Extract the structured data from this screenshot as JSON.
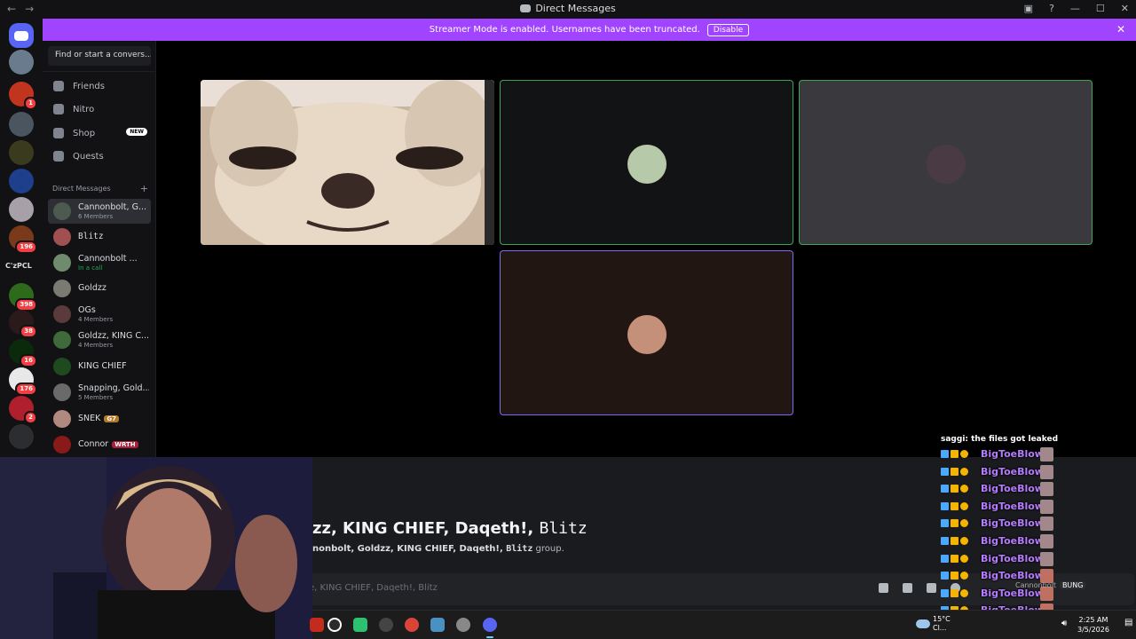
{
  "titlebar": {
    "title": "Direct Messages",
    "back": "←",
    "forward": "→"
  },
  "banner": {
    "text": "Streamer Mode is enabled. Usernames have been truncated.",
    "disable_label": "Disable",
    "close": "✕",
    "color": "#a044ff"
  },
  "servers": {
    "badges": [
      "1",
      "196",
      "398",
      "38",
      "16",
      "176",
      "2"
    ],
    "text_server": "C'zPCL"
  },
  "dm_sidebar": {
    "search_placeholder": "Find or start a convers...",
    "nav": [
      {
        "label": "Friends",
        "icon": "friends-icon"
      },
      {
        "label": "Nitro",
        "icon": "nitro-icon"
      },
      {
        "label": "Shop",
        "icon": "shop-icon",
        "badge": "NEW"
      },
      {
        "label": "Quests",
        "icon": "quests-icon"
      }
    ],
    "section_header": "Direct Messages",
    "section_add": "+",
    "conversations": [
      {
        "name": "Cannonbolt, G...",
        "sub": "6 Members",
        "active": true
      },
      {
        "name": "Blitz",
        "sub": ""
      },
      {
        "name": "Cannonbolt ...",
        "sub": "In a call"
      },
      {
        "name": "Goldzz",
        "sub": ""
      },
      {
        "name": "OGs",
        "sub": "4 Members"
      },
      {
        "name": "Goldzz, KING C...",
        "sub": "4 Members"
      },
      {
        "name": "KING CHIEF",
        "sub": ""
      },
      {
        "name": "Snapping, Gold...",
        "sub": "5 Members"
      },
      {
        "name": "SNEK",
        "sub": "",
        "tag": "G7"
      },
      {
        "name": "Connor",
        "sub": "",
        "tag": "WRTH"
      }
    ]
  },
  "chat": {
    "title_main": "zz, KING CHIEF, Daqeth!, ",
    "title_mono": "Blitz",
    "desc_pre": "nonbolt, Goldzz, KING CHIEF, Daqeth!, ",
    "desc_mono": "Blitz",
    "desc_post": " group.",
    "input_placeholder": "e, KING CHIEF, Daqeth!, Blitz"
  },
  "overlay": {
    "top_line": "saggi: the        files got leaked",
    "name": "BigToeBlow:",
    "tray_name": "Cannonbolt",
    "tray_tag": "BUNG",
    "name_color": "#b57cff"
  },
  "taskbar": {
    "weather_temp": "15°C",
    "weather_cond": "Cl...",
    "time": "2:25 AM",
    "date": "3/5/2026"
  }
}
